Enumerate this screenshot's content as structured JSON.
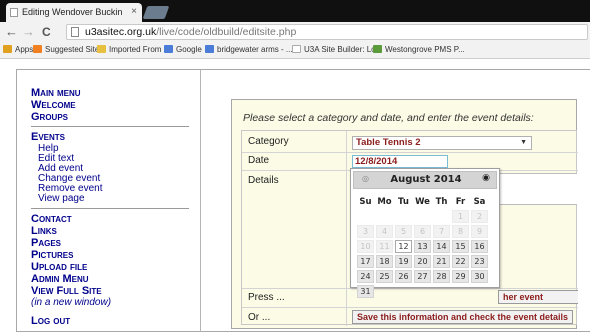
{
  "browser": {
    "tab_title": "Editing Wendover Buckin",
    "tab_close": "×",
    "nav_back": "←",
    "nav_forward": "→",
    "nav_reload": "C",
    "url_host": "u3asitec.org.uk",
    "url_path": "/live/code/oldbuild/editsite.php",
    "bookmarks": [
      {
        "label": "Apps",
        "color": "#e0a020"
      },
      {
        "label": "Suggested Sites",
        "color": "#f08020"
      },
      {
        "label": "Imported From IE",
        "color": "#e8c040"
      },
      {
        "label": "Google",
        "color": "#4a7cd8"
      },
      {
        "label": "bridgewater arms - ...",
        "color": "#4a7cd8"
      },
      {
        "label": "U3A Site Builder: Lo...",
        "color": "#cccccc"
      },
      {
        "label": "Westongrove PMS P...",
        "color": "#5a9a3a"
      }
    ]
  },
  "sidebar": {
    "main_menu": "Main menu",
    "welcome": "Welcome",
    "groups": "Groups",
    "events": "Events",
    "event_items": [
      "Help",
      "Edit text",
      "Add event",
      "Change event",
      "Remove event",
      "View page"
    ],
    "contact": "Contact",
    "links": "Links",
    "pages": "Pages",
    "pictures": "Pictures",
    "upload_file": "Upload file",
    "admin_menu": "Admin Menu",
    "view_full_site": "View Full Site",
    "new_window_note": "(in a new window)",
    "log_out": "Log out"
  },
  "form": {
    "prompt": "Please select a category and date, and enter the event details:",
    "category_label": "Category",
    "category_value": "Table Tennis 2",
    "date_label": "Date",
    "date_value": "12/8/2014",
    "details_label": "Details",
    "press_label": "Press ...",
    "or_label": "Or ...",
    "save_button_visible": "her event",
    "check_button": "Save this information and check the event details"
  },
  "datepicker": {
    "title": "August 2014",
    "prev": "◎",
    "next": "◉",
    "weekdays": [
      "Su",
      "Mo",
      "Tu",
      "We",
      "Th",
      "Fr",
      "Sa"
    ],
    "weeks": [
      [
        "",
        "",
        "",
        "",
        "",
        "1",
        "2"
      ],
      [
        "3",
        "4",
        "5",
        "6",
        "7",
        "8",
        "9"
      ],
      [
        "10",
        "11",
        "12",
        "13",
        "14",
        "15",
        "16"
      ],
      [
        "17",
        "18",
        "19",
        "20",
        "21",
        "22",
        "23"
      ],
      [
        "24",
        "25",
        "26",
        "27",
        "28",
        "29",
        "30"
      ],
      [
        "31",
        "",
        "",
        "",
        "",
        "",
        ""
      ]
    ],
    "selected_day": "12"
  }
}
